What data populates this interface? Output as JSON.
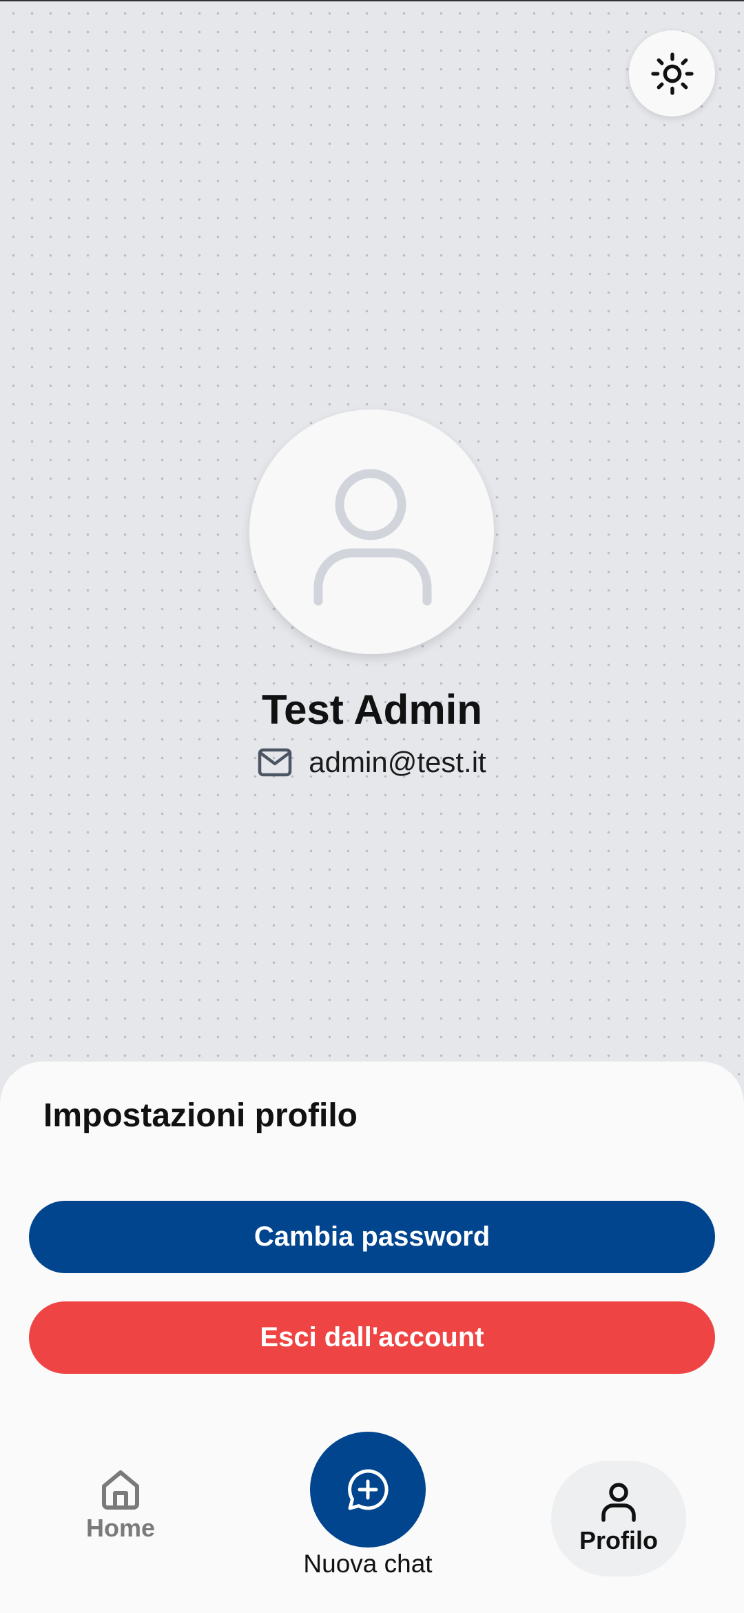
{
  "header": {
    "theme_toggle_icon": "sun-icon"
  },
  "profile": {
    "avatar_icon": "user-placeholder-icon",
    "name": "Test Admin",
    "email_icon": "mail-icon",
    "email": "admin@test.it"
  },
  "settings": {
    "title": "Impostazioni profilo",
    "change_password_label": "Cambia password",
    "logout_label": "Esci dall'account"
  },
  "nav": {
    "home": {
      "label": "Home",
      "icon": "home-icon"
    },
    "new_chat": {
      "label": "Nuova chat",
      "icon": "chat-plus-icon"
    },
    "profile": {
      "label": "Profilo",
      "icon": "user-icon",
      "active": true
    }
  },
  "colors": {
    "primary": "#00458e",
    "danger": "#ef4444",
    "background": "#e5e7eb",
    "sheet": "#fafafa",
    "muted": "#7a7a7a"
  }
}
